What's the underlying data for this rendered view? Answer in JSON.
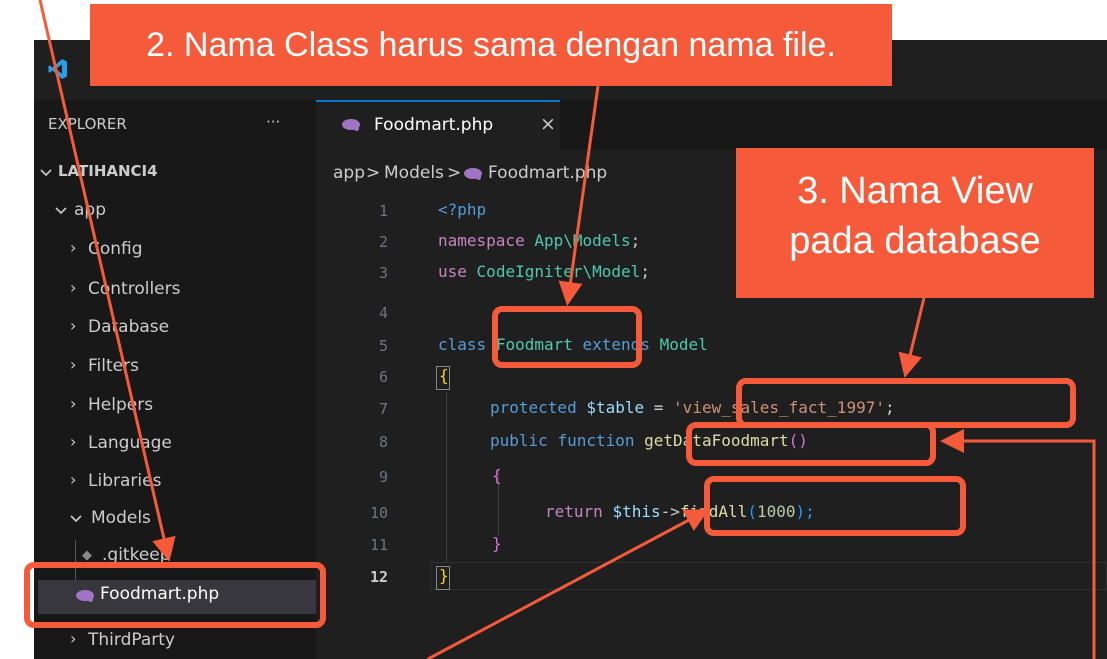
{
  "callouts": {
    "class_name": "2. Nama Class harus sama dengan nama file.",
    "view_line1": "3. Nama View",
    "view_line2": "pada database"
  },
  "explorer": {
    "title": "EXPLORER",
    "more": "···",
    "project": "LATIHANCI4",
    "root_folder": "app",
    "folders": [
      "Config",
      "Controllers",
      "Database",
      "Filters",
      "Helpers",
      "Language",
      "Libraries"
    ],
    "models_folder": "Models",
    "models_files": [
      ".gitkeep",
      "Foodmart.php"
    ],
    "cut_off": "ThirdParty"
  },
  "tab": {
    "label": "Foodmart.php",
    "close": "×"
  },
  "breadcrumb": {
    "seg1": "app",
    "seg2": "Models",
    "seg3": "Foodmart.php",
    "sep": ">"
  },
  "code": {
    "line_numbers": [
      "1",
      "2",
      "3",
      "4",
      "5",
      "6",
      "7",
      "8",
      "9",
      "10",
      "11",
      "12"
    ],
    "l1": "<?php",
    "l2_kw": "namespace",
    "l2_ns": "App\\Models",
    "l2_end": ";",
    "l3_kw": "use",
    "l3_ns": "CodeIgniter\\Model",
    "l3_end": ";",
    "l5_kw": "class",
    "l5_name": "Foodmart",
    "l5_ext": "extends",
    "l5_base": "Model",
    "l6": "{",
    "l7_kw": "protected",
    "l7_var": "$table",
    "l7_eq": " = ",
    "l7_str": "'view_sales_fact_1997'",
    "l7_end": ";",
    "l8_kw": "public",
    "l8_fn_kw": "function",
    "l8_name": "getDataFoodmart",
    "l8_par": "()",
    "l9": "{",
    "l10_kw": "return",
    "l10_var": "$this",
    "l10_arrow": "->",
    "l10_method": "findAll",
    "l10_open": "(",
    "l10_num": "1000",
    "l10_close": ");",
    "l11": "}",
    "l12": "}"
  },
  "colors": {
    "annotation": "#f55b3a",
    "editor_bg": "#1f1f1f",
    "sidebar_bg": "#181818",
    "tab_accent": "#0078d4"
  }
}
